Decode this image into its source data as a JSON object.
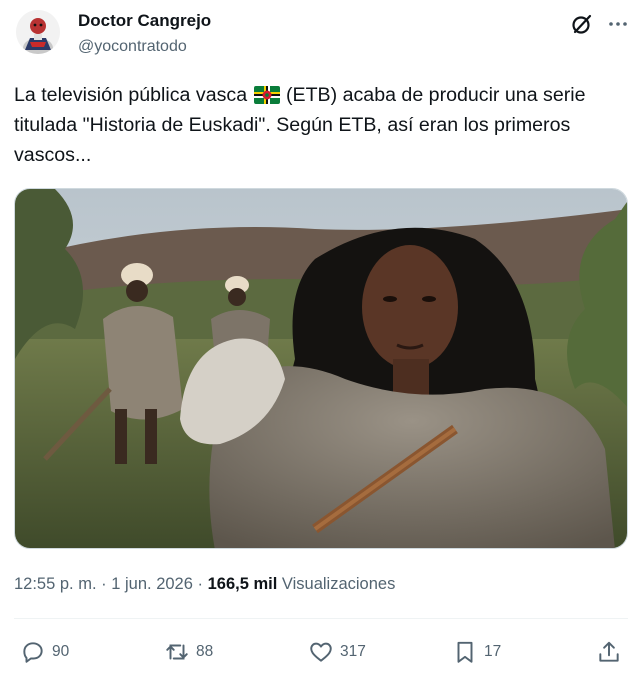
{
  "author": {
    "display_name": "Doctor Cangrejo",
    "handle": "@yocontratodo"
  },
  "tweet": {
    "text_before_flag": "La televisión pública vasca",
    "flag_emoji": "flag-dominica",
    "text_after_flag": "(ETB) acaba de producir una serie titulada \"Historia de Euskadi\". Según ETB, así eran los primeros vascos..."
  },
  "meta": {
    "time": "12:55 p. m.",
    "sep1": "·",
    "date": "1 jun. 2026",
    "sep2": "·",
    "views_count": "166,5 mil",
    "views_label": "Visualizaciones"
  },
  "actions": {
    "reply": {
      "count": "90",
      "icon": "reply-icon"
    },
    "retweet": {
      "count": "88",
      "icon": "retweet-icon"
    },
    "like": {
      "count": "317",
      "icon": "heart-icon"
    },
    "bookmark": {
      "count": "17",
      "icon": "bookmark-icon"
    },
    "share": {
      "icon": "share-icon"
    }
  },
  "header_icons": [
    "grok-icon",
    "more-icon"
  ],
  "colors": {
    "text_primary": "#0f1419",
    "text_secondary": "#536471",
    "border": "#cfd9de"
  }
}
